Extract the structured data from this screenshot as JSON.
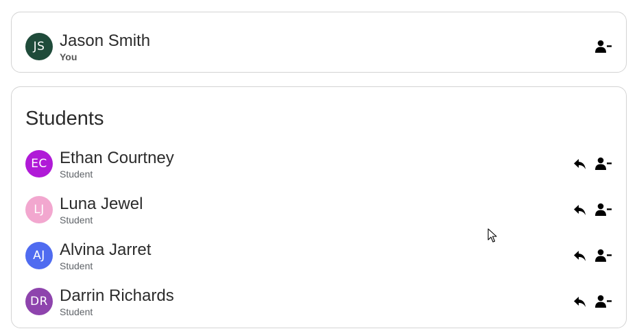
{
  "me": {
    "initials": "JS",
    "name": "Jason Smith",
    "label": "You",
    "avatar_color": "#1f4b3a"
  },
  "students_section": {
    "title": "Students",
    "items": [
      {
        "initials": "EC",
        "name": "Ethan Courtney",
        "role": "Student",
        "avatar_color": "#b01ad7"
      },
      {
        "initials": "LJ",
        "name": "Luna Jewel",
        "role": "Student",
        "avatar_color": "#f2a7cf"
      },
      {
        "initials": "AJ",
        "name": "Alvina Jarret",
        "role": "Student",
        "avatar_color": "#4f6bf0"
      },
      {
        "initials": "DR",
        "name": "Darrin Richards",
        "role": "Student",
        "avatar_color": "#8e44ad"
      }
    ]
  },
  "icons": {
    "remove": "person-remove-icon",
    "reply": "reply-icon"
  }
}
